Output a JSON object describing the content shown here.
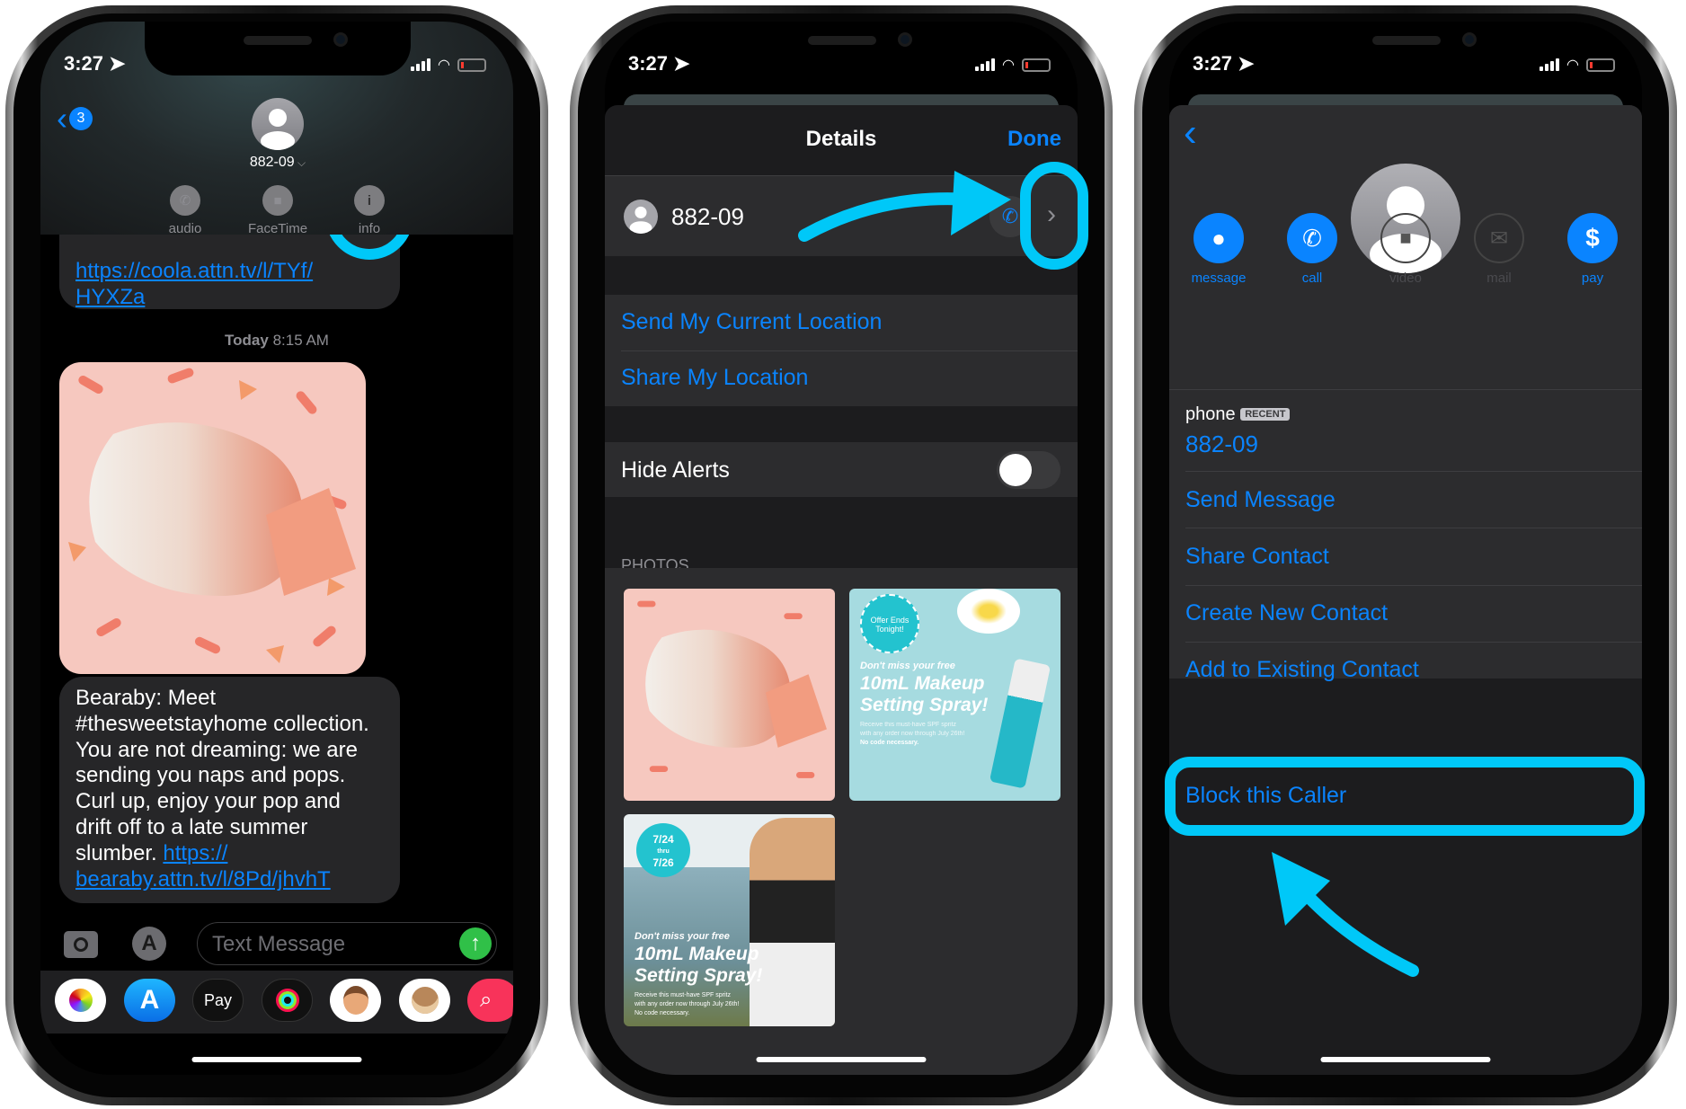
{
  "accent_color": "#0a84ff",
  "annotation_color": "#00c8f8",
  "status": {
    "time": "3:27"
  },
  "messages_screen": {
    "back_badge": "3",
    "contact_name": "882-09",
    "actions": [
      {
        "label": "audio",
        "icon": "phone-icon"
      },
      {
        "label": "FaceTime",
        "icon": "video-icon"
      },
      {
        "label": "info",
        "icon": "info-icon"
      }
    ],
    "prev_message_link": [
      "https://coola.attn.tv/l/TYf/",
      "HYXZa"
    ],
    "timestamp_day": "Today",
    "timestamp_time": "8:15 AM",
    "message_lines": [
      "Bearaby: Meet",
      "#thesweetstayhome collection.",
      "You are not dreaming: we are",
      "sending you naps and pops.",
      "Curl up, enjoy your pop and",
      "drift off to a late summer"
    ],
    "message_last_text": "slumber. ",
    "message_link": [
      "https://",
      "bearaby.attn.tv/l/8Pd/jhvhT"
    ],
    "input_placeholder": "Text Message",
    "apps": [
      "photos-app",
      "app-store-app",
      "apple-pay-app",
      "activity-app",
      "memoji-app",
      "animoji-app",
      "search-images-app"
    ],
    "apple_pay_label": "Pay"
  },
  "details_screen": {
    "title": "Details",
    "done": "Done",
    "contact": "882-09",
    "location_items": [
      "Send My Current Location",
      "Share My Location"
    ],
    "hide_alerts": {
      "label": "Hide Alerts",
      "on": false
    },
    "photos_header": "PHOTOS",
    "photos": [
      {
        "kind": "bearaby-product-photo"
      },
      {
        "badge": [
          "Offer Ends",
          "Tonight!"
        ],
        "line1": "Don't miss your free",
        "line2": "10mL Makeup",
        "line3": "Setting Spray!",
        "fine1": "Receive this must-have SPF spritz",
        "fine2": "with any order now through July 26th!",
        "fine3": "No code necessary."
      },
      {
        "badge": [
          "7/24",
          "thru",
          "7/26"
        ],
        "line1": "Don't miss your free",
        "line2": "10mL Makeup",
        "line3": "Setting Spray!",
        "fine1": "Receive this must-have SPF spritz",
        "fine2": "with any order now through July 26th!",
        "fine3": "No code necessary."
      }
    ]
  },
  "contact_screen": {
    "actions": [
      {
        "label": "message",
        "enabled": true
      },
      {
        "label": "call",
        "enabled": true
      },
      {
        "label": "video",
        "enabled": false
      },
      {
        "label": "mail",
        "enabled": false
      },
      {
        "label": "pay",
        "enabled": true
      }
    ],
    "phone_label": "phone",
    "recent_badge": "RECENT",
    "phone_number": "882-09",
    "items": [
      "Send Message",
      "Share Contact",
      "Create New Contact",
      "Add to Existing Contact"
    ],
    "block": "Block this Caller"
  }
}
